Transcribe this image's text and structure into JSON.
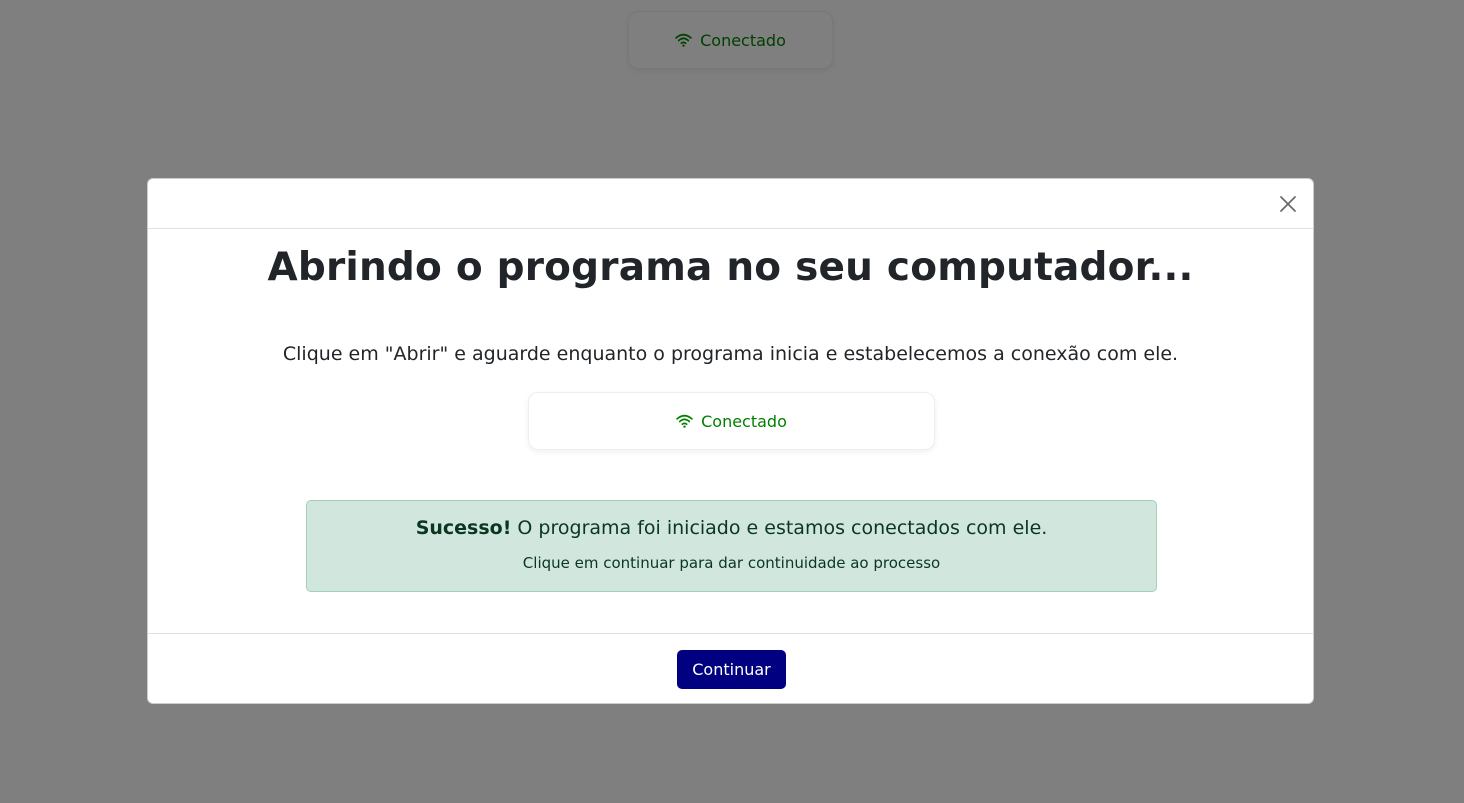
{
  "background": {
    "status_text": "Conectado",
    "status_icon": "wifi-icon"
  },
  "modal": {
    "title": "Abrindo o programa no seu computador...",
    "instruction": "Clique em \"Abrir\" e aguarde enquanto o programa inicia e estabelecemos a conexão com ele.",
    "status_text": "Conectado",
    "status_icon": "wifi-icon",
    "close_icon": "close-icon",
    "alert": {
      "strong": "Sucesso!",
      "message": " O programa foi iniciado e estamos conectados com ele.",
      "detail": "Clique em continuar para dar continuidade ao processo"
    },
    "continue_label": "Continuar"
  },
  "colors": {
    "status_green": "#008000",
    "primary_button": "#000080",
    "alert_bg": "#d1e7dd",
    "alert_text": "#0a3622"
  }
}
